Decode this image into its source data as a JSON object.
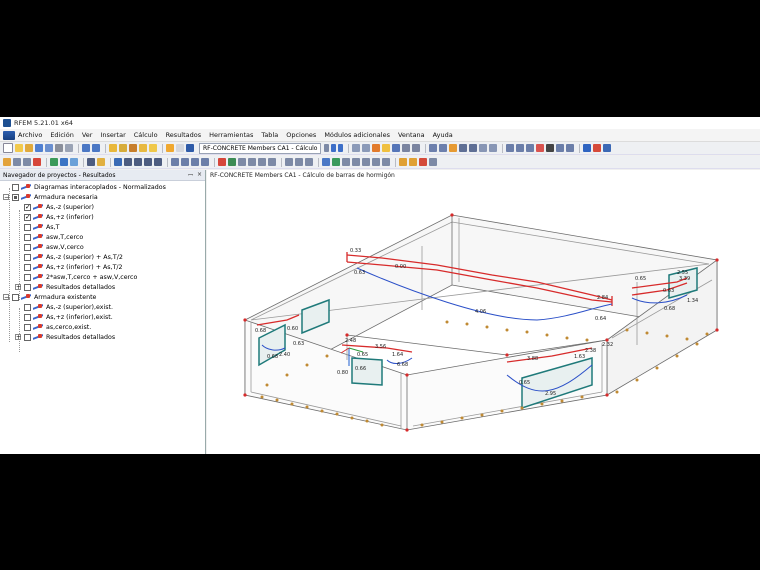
{
  "window": {
    "title": "RFEM 5.21.01 x64"
  },
  "menu": [
    {
      "label": "Archivo"
    },
    {
      "label": "Edición"
    },
    {
      "label": "Ver"
    },
    {
      "label": "Insertar"
    },
    {
      "label": "Cálculo"
    },
    {
      "label": "Resultados"
    },
    {
      "label": "Herramientas"
    },
    {
      "label": "Tabla"
    },
    {
      "label": "Opciones"
    },
    {
      "label": "Módulos adicionales"
    },
    {
      "label": "Ventana"
    },
    {
      "label": "Ayuda"
    }
  ],
  "toolbar": {
    "case_combo": "RF-CONCRETE Members CA1 - Cálculo"
  },
  "navigator": {
    "title": "Navegador de proyectos - Resultados",
    "pin": "ꟷ",
    "close": "×",
    "items": [
      {
        "label": "Diagramas interacoplados - Normalizados"
      },
      {
        "label": "Armadura necesaria"
      },
      {
        "label": "As,-z (superior)"
      },
      {
        "label": "As,+z (inferior)"
      },
      {
        "label": "As,T"
      },
      {
        "label": "asw,T,cerco"
      },
      {
        "label": "asw,V,cerco"
      },
      {
        "label": "As,-z (superior) + As,T/2"
      },
      {
        "label": "As,+z (inferior) + As,T/2"
      },
      {
        "label": "2*asw,T,cerco + asw,V,cerco"
      },
      {
        "label": "Resultados detallados"
      },
      {
        "label": "Armadura existente"
      },
      {
        "label": "As,-z (superior),exist."
      },
      {
        "label": "As,+z (inferior),exist."
      },
      {
        "label": "as,cerco,exist."
      },
      {
        "label": "Resultados detallados"
      }
    ]
  },
  "view": {
    "title": "RF-CONCRETE Members CA1 - Cálculo de barras de hormigón",
    "labels": [
      "0.33",
      "0.00",
      "0.63",
      "4.06",
      "2.84",
      "0.64",
      "0.65",
      "2.48",
      "0.68",
      "0.60",
      "0.63",
      "3.88",
      "2.95",
      "0.65",
      "1.63",
      "2.38",
      "0.63",
      "3.39",
      "2.55",
      "0.68",
      "3.56",
      "1.64",
      "0.65",
      "6.68",
      "0.68",
      "2.40",
      "0.66",
      "0.80",
      "2.32",
      "1.34"
    ]
  },
  "colors": {
    "accent": "#1d4f91",
    "result_red": "#d72b2b",
    "result_blue": "#2b50c8",
    "support": "#c08a33"
  }
}
